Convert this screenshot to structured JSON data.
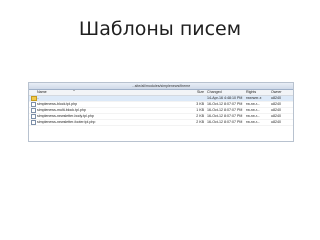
{
  "slide": {
    "title": "Шаблоны писем"
  },
  "window": {
    "path": "...site/all/modules/simplenews/theme"
  },
  "columns": {
    "name": "Name",
    "size": "Size",
    "changed": "Changed",
    "rights": "Rights",
    "owner": "Owner"
  },
  "rows": [
    {
      "icon": "parent-folder-icon",
      "name": "..",
      "size": "",
      "changed": "14-Apr-16 4:48:10 PM",
      "rights": "rwxrwxr-x",
      "owner": "u8240"
    },
    {
      "icon": "php-file-icon",
      "name": "simplenews-block.tpl.php",
      "size": "3 KB",
      "changed": "16-Oct-12 8:07:07 PM",
      "rights": "rw-rw-r--",
      "owner": "u8240"
    },
    {
      "icon": "php-file-icon",
      "name": "simplenews-multi-block.tpl.php",
      "size": "1 KB",
      "changed": "16-Oct-12 8:07:07 PM",
      "rights": "rw-rw-r--",
      "owner": "u8240"
    },
    {
      "icon": "php-file-icon",
      "name": "simplenews-newsletter-body.tpl.php",
      "size": "2 KB",
      "changed": "16-Oct-12 8:07:07 PM",
      "rights": "rw-rw-r--",
      "owner": "u8240"
    },
    {
      "icon": "php-file-icon",
      "name": "simplenews-newsletter-footer.tpl.php",
      "size": "2 KB",
      "changed": "16-Oct-12 8:07:07 PM",
      "rights": "rw-rw-r--",
      "owner": "u8240"
    }
  ]
}
